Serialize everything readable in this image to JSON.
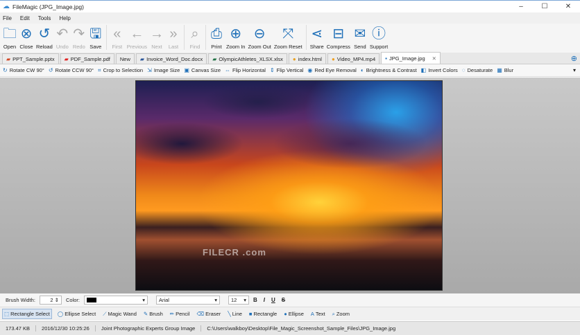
{
  "window": {
    "title": "FileMagic (JPG_Image.jpg)",
    "minimize": "–",
    "maximize": "☐",
    "close": "✕"
  },
  "menu": [
    "File",
    "Edit",
    "Tools",
    "Help"
  ],
  "toolbar": [
    {
      "label": "Open",
      "icon": "folder-icon",
      "glyph": "🗀",
      "disabled": false
    },
    {
      "label": "Close",
      "icon": "close-circle-icon",
      "glyph": "⊗",
      "disabled": false
    },
    {
      "label": "Reload",
      "icon": "reload-icon",
      "glyph": "↺",
      "disabled": false
    },
    {
      "label": "Undo",
      "icon": "undo-icon",
      "glyph": "↶",
      "disabled": true
    },
    {
      "label": "Redo",
      "icon": "redo-icon",
      "glyph": "↷",
      "disabled": true
    },
    {
      "label": "Save",
      "icon": "save-icon",
      "glyph": "🖫",
      "disabled": false,
      "sepAfter": true
    },
    {
      "label": "First",
      "icon": "double-chevron-left-icon",
      "glyph": "«",
      "disabled": true
    },
    {
      "label": "Previous",
      "icon": "arrow-left-icon",
      "glyph": "←",
      "disabled": true
    },
    {
      "label": "Next",
      "icon": "arrow-right-icon",
      "glyph": "→",
      "disabled": true
    },
    {
      "label": "Last",
      "icon": "double-chevron-right-icon",
      "glyph": "»",
      "disabled": true,
      "sepAfter": true
    },
    {
      "label": "Find",
      "icon": "search-icon",
      "glyph": "⌕",
      "disabled": true,
      "sepAfter": true
    },
    {
      "label": "Print",
      "icon": "printer-icon",
      "glyph": "⎙",
      "disabled": false
    },
    {
      "label": "Zoom In",
      "icon": "zoom-in-icon",
      "glyph": "⊕",
      "disabled": false
    },
    {
      "label": "Zoom Out",
      "icon": "zoom-out-icon",
      "glyph": "⊖",
      "disabled": false
    },
    {
      "label": "Zoom Reset",
      "icon": "zoom-reset-icon",
      "glyph": "⤧",
      "disabled": false,
      "sepAfter": true
    },
    {
      "label": "Share",
      "icon": "share-icon",
      "glyph": "⋖",
      "disabled": false
    },
    {
      "label": "Compress",
      "icon": "compress-icon",
      "glyph": "⊟",
      "disabled": false
    },
    {
      "label": "Send",
      "icon": "mail-icon",
      "glyph": "✉",
      "disabled": false
    },
    {
      "label": "Support",
      "icon": "info-icon",
      "glyph": "ⓘ",
      "disabled": false
    }
  ],
  "tabs": [
    {
      "label": "PPT_Sample.pptx",
      "glyph": "▰",
      "color": "#d24726"
    },
    {
      "label": "PDF_Sample.pdf",
      "glyph": "▰",
      "color": "#e02020"
    },
    {
      "label": "New",
      "glyph": "",
      "color": ""
    },
    {
      "label": "Invoice_Word_Doc.docx",
      "glyph": "▰",
      "color": "#2b579a"
    },
    {
      "label": "OlympicAthletes_XLSX.xlsx",
      "glyph": "▰",
      "color": "#217346"
    },
    {
      "label": "index.html",
      "glyph": "●",
      "color": "#e8a020"
    },
    {
      "label": "Video_MP4.mp4",
      "glyph": "●",
      "color": "#f0a020"
    },
    {
      "label": "JPG_Image.jpg",
      "glyph": "▪",
      "color": "#1e6fb8",
      "active": true,
      "close": "✕"
    }
  ],
  "add_tab": "⊕",
  "image_tools": [
    {
      "label": "Rotate CW 90°",
      "glyph": "↻"
    },
    {
      "label": "Rotate CCW 90°",
      "glyph": "↺"
    },
    {
      "label": "Crop to Selection",
      "glyph": "⌗"
    },
    {
      "label": "Image Size",
      "glyph": "⇲"
    },
    {
      "label": "Canvas Size",
      "glyph": "▣"
    },
    {
      "label": "Flip Horizontal",
      "glyph": "⇔"
    },
    {
      "label": "Flip Vertical",
      "glyph": "⇕"
    },
    {
      "label": "Red Eye Removal",
      "glyph": "◉"
    },
    {
      "label": "Brightness & Contrast",
      "glyph": "◐"
    },
    {
      "label": "Invert Colors",
      "glyph": "◧"
    },
    {
      "label": "Desaturate",
      "glyph": "◌"
    },
    {
      "label": "Blur",
      "glyph": "▦"
    }
  ],
  "watermark": "FILECR .com",
  "brush": {
    "width_label": "Brush Width:",
    "width_value": "2",
    "color_label": "Color:",
    "color_value": "#000000",
    "font": "Arial",
    "size": "12",
    "bold": "B",
    "italic": "I",
    "underline": "U",
    "strike": "S"
  },
  "draw_tools": [
    {
      "label": "Rectangle Select",
      "glyph": "⬚",
      "active": true
    },
    {
      "label": "Ellipse Select",
      "glyph": "◯"
    },
    {
      "label": "Magic Wand",
      "glyph": "⟋"
    },
    {
      "label": "Brush",
      "glyph": "✎"
    },
    {
      "label": "Pencil",
      "glyph": "✏"
    },
    {
      "label": "Eraser",
      "glyph": "⌫"
    },
    {
      "label": "Line",
      "glyph": "╲"
    },
    {
      "label": "Rectangle",
      "glyph": "■"
    },
    {
      "label": "Ellipse",
      "glyph": "●"
    },
    {
      "label": "Text",
      "glyph": "A"
    },
    {
      "label": "Zoom",
      "glyph": "⌕"
    }
  ],
  "status": {
    "size": "173.47 KB",
    "date": "2016/12/30 10:25:26",
    "type": "Joint Photographic Experts Group Image",
    "path": "C:\\Users\\walkboy\\Desktop\\File_Magic_Screenshot_Sample_Files\\JPG_Image.jpg"
  }
}
